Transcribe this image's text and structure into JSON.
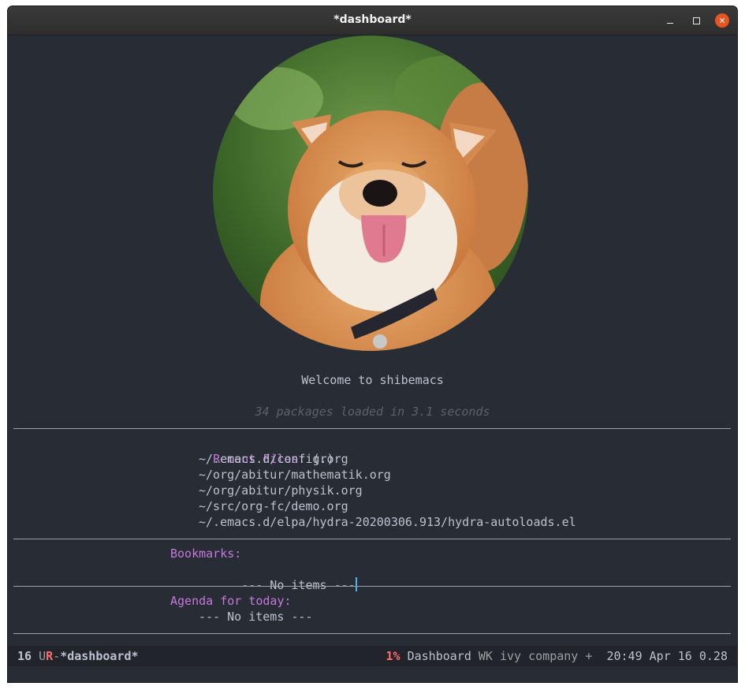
{
  "window": {
    "title": "*dashboard*"
  },
  "titlebar": {
    "minimize_icon": "minimize-icon",
    "maximize_icon": "maximize-icon",
    "close_icon": "close-icon",
    "close_glyph": "✕"
  },
  "banner": {
    "welcome": "Welcome to shibemacs",
    "loaded": "34 packages loaded in 3.1 seconds"
  },
  "recent": {
    "heading": "Recent Files:",
    "key": "(r)",
    "items": [
      "~/.emacs.d/config.org",
      "~/org/abitur/mathematik.org",
      "~/org/abitur/physik.org",
      "~/src/org-fc/demo.org",
      "~/.emacs.d/elpa/hydra-20200306.913/hydra-autoloads.el"
    ]
  },
  "bookmarks": {
    "heading": "Bookmarks:",
    "empty": "--- No items ---"
  },
  "agenda": {
    "heading": "Agenda for today:",
    "empty": "--- No items ---"
  },
  "modeline": {
    "line": "16",
    "flag_u": "U",
    "flag_r": "R",
    "sep": "-",
    "buffer": "*dashboard*",
    "percent": "1%",
    "major_mode": "Dashboard",
    "minor_modes": "WK ivy company +",
    "time": "20:49",
    "date": "Apr 16",
    "load": "0.28"
  },
  "colors": {
    "background": "#282c34",
    "heading": "#c678dd",
    "text": "#bbc2cf",
    "comment": "#5b6268",
    "accent_red": "#ff6c6b",
    "cursor": "#51afef"
  }
}
